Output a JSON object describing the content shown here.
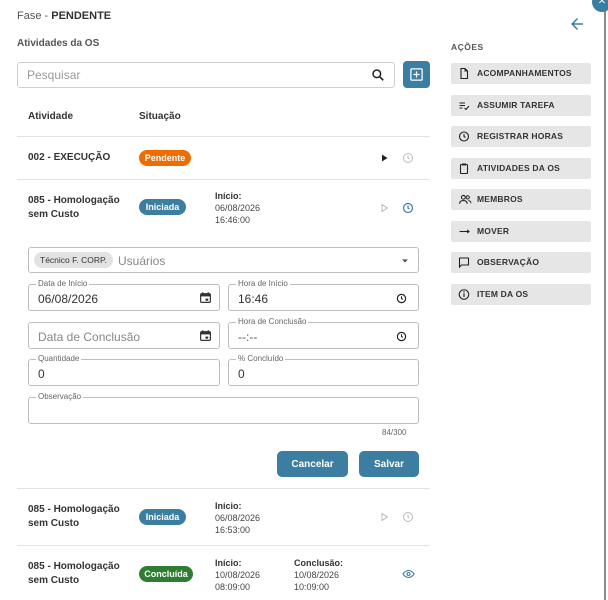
{
  "header": {
    "phase_label": "Fase - ",
    "phase_value": "PENDENTE",
    "section_title": "Atividades da OS"
  },
  "search": {
    "placeholder": "Pesquisar"
  },
  "table": {
    "col_activity": "Atividade",
    "col_status": "Situação",
    "rows": [
      {
        "name": "002 - EXECUÇÃO",
        "status": "Pendente"
      },
      {
        "name_l1": "085 - Homologação",
        "name_l2": "sem Custo",
        "status": "Iniciada",
        "start_label": "Início:",
        "start_date": "06/08/2026",
        "start_time": "16:46:00"
      },
      {
        "name_l1": "085 - Homologação",
        "name_l2": "sem Custo",
        "status": "Iniciada",
        "start_label": "Início:",
        "start_date": "06/08/2026",
        "start_time": "16:53:00"
      },
      {
        "name_l1": "085 - Homologação",
        "name_l2": "sem Custo",
        "status": "Concluída",
        "start_label": "Início:",
        "start_date": "10/08/2026",
        "start_time": "08:09:00",
        "end_label": "Conclusão:",
        "end_date": "10/08/2026",
        "end_time": "10:09:00"
      }
    ]
  },
  "form": {
    "user_chip": "Técnico F. CORP.",
    "users_placeholder": "Usuários",
    "start_date_label": "Data de Início",
    "start_date_value": "06/08/2026",
    "start_time_label": "Hora de Início",
    "start_time_value": "16:46",
    "end_date_placeholder": "Data de Conclusão",
    "end_time_label": "Hora de Conclusão",
    "end_time_value": "--:--",
    "qty_label": "Quantidade",
    "qty_value": "0",
    "pct_label": "% Concluído",
    "pct_value": "0",
    "obs_label": "Observação",
    "counter": "84/300",
    "cancel": "Cancelar",
    "save": "Salvar"
  },
  "actions": {
    "title": "AÇÕES",
    "items": [
      {
        "label": "ACOMPANHAMENTOS",
        "icon": "document-icon"
      },
      {
        "label": "ASSUMIR TAREFA",
        "icon": "checklist-icon"
      },
      {
        "label": "REGISTRAR HORAS",
        "icon": "clock-icon"
      },
      {
        "label": "ATIVIDADES DA OS",
        "icon": "clipboard-icon"
      },
      {
        "label": "MEMBROS",
        "icon": "people-icon"
      },
      {
        "label": "MOVER",
        "icon": "arrow-right-icon"
      },
      {
        "label": "OBSERVAÇÃO",
        "icon": "comment-icon"
      },
      {
        "label": "ITEM DA OS",
        "icon": "info-icon"
      }
    ]
  },
  "colors": {
    "primary": "#3b7ea1",
    "pending": "#ef6c00",
    "done": "#2e7d32"
  }
}
